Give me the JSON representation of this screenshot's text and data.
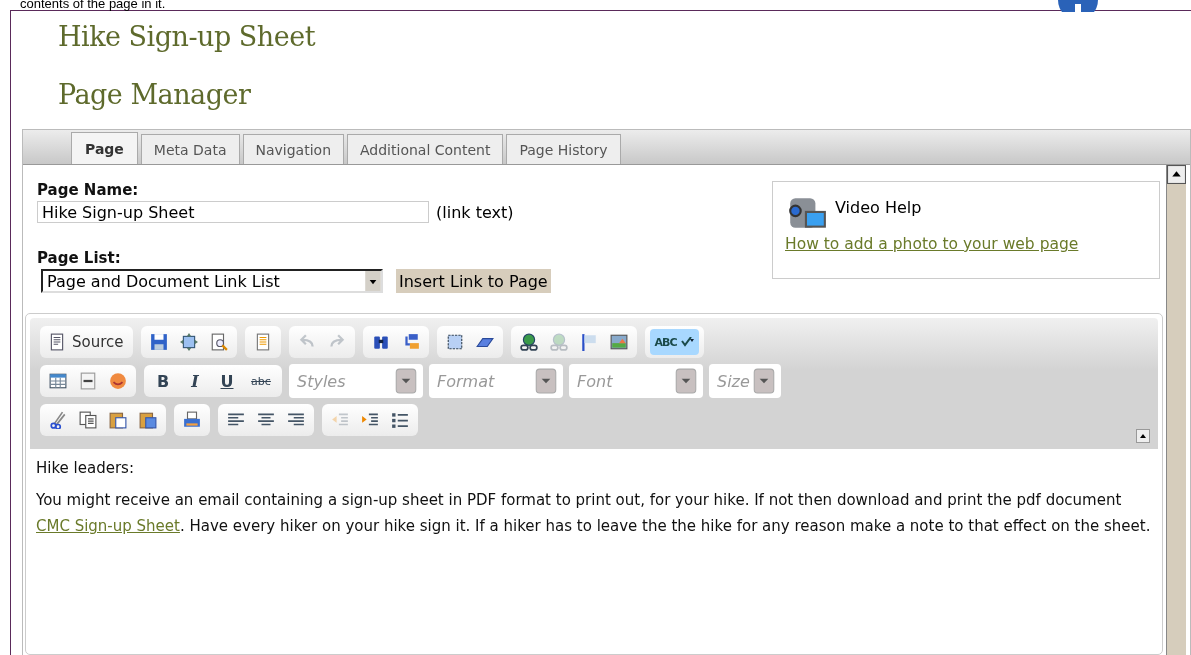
{
  "intro_text": "contents of the page in it.",
  "page_title": "Hike Sign-up Sheet",
  "section_title": "Page Manager",
  "tabs": [
    {
      "label": "Page",
      "selected": true
    },
    {
      "label": "Meta Data",
      "selected": false
    },
    {
      "label": "Navigation",
      "selected": false
    },
    {
      "label": "Additional Content",
      "selected": false
    },
    {
      "label": "Page History",
      "selected": false
    }
  ],
  "page_name": {
    "label": "Page Name:",
    "value": "Hike Sign-up Sheet",
    "note": "(link text)"
  },
  "page_list": {
    "label": "Page List:",
    "value": "Page and Document Link List",
    "button": "Insert Link to Page"
  },
  "video_help": {
    "title": "Video Help",
    "link": "How to add a photo to your web page"
  },
  "toolbar": [
    [
      {
        "items": [
          {
            "kind": "text_icon",
            "label": "Source"
          }
        ]
      },
      {
        "items": [
          {
            "kind": "icon",
            "disabled": false
          },
          {
            "kind": "icon",
            "disabled": false
          },
          {
            "kind": "icon",
            "disabled": false
          }
        ]
      },
      {
        "items": [
          {
            "kind": "icon",
            "disabled": false
          }
        ]
      },
      {
        "items": [
          {
            "kind": "icon",
            "disabled": true
          },
          {
            "kind": "icon",
            "disabled": true
          }
        ]
      },
      {
        "items": [
          {
            "kind": "icon",
            "disabled": false
          },
          {
            "kind": "icon",
            "disabled": false
          }
        ]
      },
      {
        "items": [
          {
            "kind": "icon",
            "disabled": false
          },
          {
            "kind": "icon",
            "disabled": false
          }
        ]
      },
      {
        "items": [
          {
            "kind": "icon",
            "disabled": false
          },
          {
            "kind": "icon",
            "disabled": true
          },
          {
            "kind": "icon",
            "disabled": false
          },
          {
            "kind": "icon",
            "disabled": false
          }
        ]
      },
      {
        "items": [
          {
            "kind": "menu",
            "label": "ABC",
            "selected": true
          }
        ]
      }
    ],
    [
      {
        "items": [
          {
            "kind": "icon",
            "disabled": false
          },
          {
            "kind": "icon",
            "disabled": false
          },
          {
            "kind": "icon",
            "disabled": false
          }
        ]
      },
      {
        "items": [
          {
            "kind": "bold",
            "label": "B"
          },
          {
            "kind": "italic",
            "label": "I"
          },
          {
            "kind": "underline",
            "label": "U"
          },
          {
            "kind": "strike",
            "label": "abc"
          }
        ]
      },
      {
        "items": [
          {
            "kind": "combo",
            "placeholder": "Styles"
          }
        ]
      },
      {
        "items": [
          {
            "kind": "combo",
            "placeholder": "Format"
          }
        ]
      },
      {
        "items": [
          {
            "kind": "combo",
            "placeholder": "Font"
          }
        ]
      },
      {
        "items": [
          {
            "kind": "combo",
            "placeholder": "Size"
          }
        ]
      }
    ],
    [
      {
        "items": [
          {
            "kind": "icon",
            "disabled": false
          },
          {
            "kind": "icon",
            "disabled": false
          },
          {
            "kind": "icon",
            "disabled": false
          },
          {
            "kind": "icon",
            "disabled": false
          }
        ]
      },
      {
        "items": [
          {
            "kind": "icon",
            "disabled": false
          }
        ]
      },
      {
        "items": [
          {
            "kind": "icon",
            "disabled": false
          },
          {
            "kind": "icon",
            "disabled": false
          },
          {
            "kind": "icon",
            "disabled": false
          }
        ]
      },
      {
        "items": [
          {
            "kind": "icon",
            "disabled": true
          },
          {
            "kind": "icon",
            "disabled": false
          },
          {
            "kind": "icon",
            "disabled": false
          }
        ]
      }
    ]
  ],
  "content": {
    "greeting": "Hike leaders:",
    "para_before": "You might receive an email containing a sign-up sheet in PDF format to print out, for your hike.  If not then download and print the pdf document",
    "link": "CMC Sign-up Sheet",
    "para_after": ".  Have every hiker on your hike sign it.  If a hiker has to leave the the hike for any reason make a note to that effect on the sheet."
  }
}
